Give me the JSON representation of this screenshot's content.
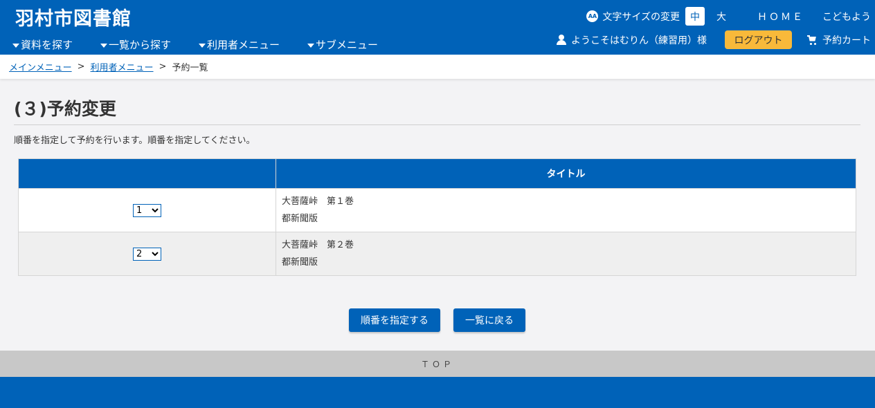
{
  "header": {
    "site_title": "羽村市図書館",
    "nav": [
      {
        "label": "資料を探す"
      },
      {
        "label": "一覧から探す"
      },
      {
        "label": "利用者メニュー"
      },
      {
        "label": "サブメニュー"
      }
    ],
    "font_size_label": "文字サイズの変更",
    "font_size_icon": "AA",
    "size_medium": "中",
    "size_large": "大",
    "home": "ＨＯＭＥ",
    "kids": "こどもよう",
    "welcome": "ようこそはむりん（練習用）様",
    "logout": "ログアウト",
    "cart": "予約カート"
  },
  "breadcrumb": {
    "items": [
      "メインメニュー",
      "利用者メニュー"
    ],
    "current": "予約一覧",
    "separator": ">"
  },
  "page": {
    "title": "(３)予約変更",
    "description": "順番を指定して予約を行います。順番を指定してください。"
  },
  "table": {
    "header_order": "",
    "header_title": "タイトル",
    "rows": [
      {
        "order": "1",
        "title": "大菩薩峠　第１巻",
        "publisher": "都新聞版"
      },
      {
        "order": "2",
        "title": "大菩薩峠　第２巻",
        "publisher": "都新聞版"
      }
    ]
  },
  "buttons": {
    "specify": "順番を指定する",
    "back": "一覧に戻る"
  },
  "footer": {
    "top": "ＴＯＰ"
  },
  "colors": {
    "primary": "#0062b8",
    "logout": "#f8b93a",
    "top_bar": "#c8c8c8"
  }
}
